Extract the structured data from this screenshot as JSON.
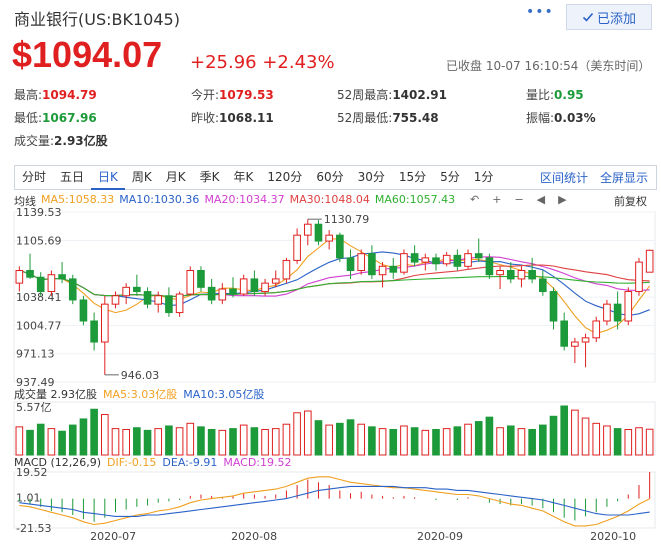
{
  "header": {
    "title": "商业银行(US:BK1045)",
    "dots": "•••",
    "added_label": "已添加",
    "price": "$1094.07",
    "change": "+25.96  +2.43%",
    "status": "已收盘 10-07 16:10:54（美东时间）"
  },
  "stats": [
    {
      "label": "最高:",
      "value": "1094.79",
      "color": "red"
    },
    {
      "label": "今开:",
      "value": "1079.53",
      "color": "red"
    },
    {
      "label": "52周最高:",
      "value": "1402.91",
      "color": "dark"
    },
    {
      "label": "量比:",
      "value": "0.95",
      "color": "green"
    },
    {
      "label": "最低:",
      "value": "1067.96",
      "color": "green"
    },
    {
      "label": "昨收:",
      "value": "1068.11",
      "color": "dark"
    },
    {
      "label": "52周最低:",
      "value": "755.48",
      "color": "dark"
    },
    {
      "label": "振幅:",
      "value": "0.03%",
      "color": "dark"
    },
    {
      "label": "成交量:",
      "value": "2.93亿股",
      "color": "dark"
    }
  ],
  "tabs": [
    "分时",
    "五日",
    "日K",
    "周K",
    "月K",
    "季K",
    "年K",
    "120分",
    "60分",
    "30分",
    "15分",
    "5分",
    "1分"
  ],
  "active_tab": "日K",
  "tab_links": [
    "区间统计",
    "全屏显示"
  ],
  "ma": {
    "label": "均线",
    "ma5": "MA5:1058.33",
    "ma10": "MA10:1030.36",
    "ma20": "MA20:1034.37",
    "ma30": "MA30:1048.04",
    "ma60": "MA60:1057.43"
  },
  "ma_colors": {
    "ma5": "#f0a020",
    "ma10": "#2a62c8",
    "ma20": "#d040d0",
    "ma30": "#e04040",
    "ma60": "#30b030"
  },
  "controls": [
    "↶",
    "+",
    "−",
    "◀",
    "▶"
  ],
  "fuquan": "前复权",
  "price_axis": [
    "1139.53",
    "1105.69",
    "1038.41",
    "1004.77",
    "971.13",
    "937.49"
  ],
  "annotations": {
    "high": "1130.79",
    "low": "946.03"
  },
  "volume": {
    "label": "成交量 2.93亿股",
    "ma5": "MA5:3.03亿股",
    "ma10": "MA10:3.05亿股",
    "axis_max": "5.57亿"
  },
  "macd": {
    "label": "MACD (12,26,9)",
    "dif": "DIF:-0.15",
    "dea": "DEA:-9.91",
    "macd": "MACD:19.52",
    "axis": [
      "19.52",
      "1.01",
      "-21.53"
    ]
  },
  "x_axis": [
    "2020-07",
    "2020-08",
    "2020-09",
    "2020-10"
  ],
  "chart_data": {
    "type": "candlestick",
    "ylim": [
      937.49,
      1139.53
    ],
    "candles": [
      [
        1055,
        1075,
        1045,
        1070
      ],
      [
        1070,
        1090,
        1060,
        1062
      ],
      [
        1062,
        1068,
        1040,
        1045
      ],
      [
        1045,
        1070,
        1040,
        1065
      ],
      [
        1065,
        1080,
        1055,
        1060
      ],
      [
        1060,
        1065,
        1030,
        1035
      ],
      [
        1035,
        1040,
        1005,
        1010
      ],
      [
        1010,
        1020,
        975,
        985
      ],
      [
        985,
        1040,
        946,
        1030
      ],
      [
        1030,
        1045,
        1025,
        1040
      ],
      [
        1040,
        1055,
        1030,
        1050
      ],
      [
        1050,
        1065,
        1040,
        1045
      ],
      [
        1045,
        1050,
        1025,
        1030
      ],
      [
        1030,
        1045,
        1020,
        1040
      ],
      [
        1040,
        1050,
        1015,
        1020
      ],
      [
        1020,
        1045,
        1015,
        1042
      ],
      [
        1042,
        1075,
        1040,
        1070
      ],
      [
        1070,
        1075,
        1045,
        1050
      ],
      [
        1050,
        1060,
        1030,
        1035
      ],
      [
        1035,
        1055,
        1030,
        1048
      ],
      [
        1048,
        1062,
        1038,
        1042
      ],
      [
        1042,
        1065,
        1040,
        1060
      ],
      [
        1060,
        1070,
        1040,
        1045
      ],
      [
        1045,
        1060,
        1040,
        1055
      ],
      [
        1055,
        1070,
        1050,
        1060
      ],
      [
        1060,
        1085,
        1055,
        1082
      ],
      [
        1082,
        1120,
        1078,
        1112
      ],
      [
        1112,
        1131,
        1100,
        1125
      ],
      [
        1125,
        1130,
        1100,
        1105
      ],
      [
        1105,
        1118,
        1095,
        1112
      ],
      [
        1112,
        1115,
        1080,
        1085
      ],
      [
        1085,
        1095,
        1060,
        1070
      ],
      [
        1070,
        1095,
        1065,
        1090
      ],
      [
        1090,
        1100,
        1060,
        1065
      ],
      [
        1065,
        1080,
        1050,
        1075
      ],
      [
        1075,
        1085,
        1060,
        1068
      ],
      [
        1068,
        1095,
        1065,
        1090
      ],
      [
        1090,
        1100,
        1075,
        1080
      ],
      [
        1080,
        1090,
        1070,
        1085
      ],
      [
        1085,
        1090,
        1070,
        1078
      ],
      [
        1078,
        1092,
        1075,
        1088
      ],
      [
        1088,
        1095,
        1070,
        1075
      ],
      [
        1075,
        1095,
        1072,
        1090
      ],
      [
        1090,
        1108,
        1080,
        1085
      ],
      [
        1085,
        1090,
        1060,
        1065
      ],
      [
        1065,
        1075,
        1048,
        1070
      ],
      [
        1070,
        1080,
        1055,
        1060
      ],
      [
        1060,
        1075,
        1050,
        1070
      ],
      [
        1070,
        1085,
        1055,
        1060
      ],
      [
        1060,
        1070,
        1040,
        1045
      ],
      [
        1045,
        1050,
        1000,
        1010
      ],
      [
        1010,
        1020,
        975,
        980
      ],
      [
        980,
        990,
        960,
        985
      ],
      [
        985,
        995,
        955,
        990
      ],
      [
        990,
        1015,
        985,
        1010
      ],
      [
        1010,
        1035,
        1005,
        1030
      ],
      [
        1030,
        1045,
        1000,
        1010
      ],
      [
        1010,
        1050,
        1005,
        1045
      ],
      [
        1045,
        1085,
        1040,
        1080
      ],
      [
        1068,
        1095,
        1068,
        1094
      ]
    ],
    "volumes": [
      3.2,
      2.8,
      3.5,
      3.0,
      2.7,
      3.4,
      4.1,
      5.2,
      4.6,
      3.0,
      2.9,
      3.1,
      2.8,
      3.0,
      3.3,
      3.1,
      3.6,
      3.2,
      2.9,
      2.8,
      3.0,
      3.4,
      3.1,
      2.9,
      3.0,
      3.5,
      4.8,
      5.0,
      3.9,
      3.4,
      3.6,
      4.0,
      3.5,
      3.2,
      3.0,
      2.9,
      3.3,
      3.1,
      2.8,
      2.9,
      3.0,
      3.2,
      3.5,
      3.8,
      4.3,
      3.1,
      3.3,
      3.0,
      2.9,
      3.4,
      4.4,
      5.57,
      5.1,
      4.2,
      3.6,
      3.3,
      3.0,
      2.9,
      3.1,
      2.93
    ],
    "macd_hist": [
      -2,
      -4,
      -6,
      -9,
      -10,
      -12,
      -15,
      -17,
      -14,
      -10,
      -8,
      -6,
      -5,
      -3,
      -2,
      -1,
      2,
      3,
      2,
      1,
      2,
      4,
      3,
      2,
      3,
      6,
      10,
      14,
      12,
      10,
      6,
      4,
      5,
      3,
      2,
      1,
      2,
      1,
      0,
      -1,
      0,
      -1,
      1,
      0,
      -3,
      -4,
      -5,
      -4,
      -5,
      -7,
      -10,
      -14,
      -16,
      -13,
      -10,
      -6,
      -2,
      3,
      10,
      19.52
    ],
    "dif": [
      -5,
      -6,
      -8,
      -10,
      -12,
      -14,
      -17,
      -19,
      -18,
      -16,
      -14,
      -12,
      -11,
      -9,
      -8,
      -6,
      -3,
      -1,
      0,
      1,
      2,
      4,
      5,
      6,
      7,
      9,
      12,
      15,
      16,
      16,
      14,
      12,
      11,
      10,
      9,
      8,
      8,
      7,
      6,
      5,
      4,
      3,
      3,
      2,
      0,
      -2,
      -4,
      -5,
      -7,
      -9,
      -13,
      -17,
      -20,
      -20,
      -19,
      -16,
      -13,
      -9,
      -4,
      -0.15
    ],
    "dea": [
      -3,
      -4,
      -5,
      -6,
      -7,
      -8,
      -10,
      -11,
      -12,
      -13,
      -13,
      -13,
      -12,
      -12,
      -11,
      -10,
      -9,
      -8,
      -7,
      -6,
      -5,
      -4,
      -3,
      -2,
      -1,
      0,
      2,
      4,
      6,
      7,
      8,
      9,
      9,
      9,
      9,
      9,
      8,
      8,
      8,
      7,
      7,
      6,
      6,
      5,
      4,
      3,
      2,
      1,
      0,
      -1,
      -3,
      -5,
      -7,
      -9,
      -11,
      -12,
      -12,
      -12,
      -11,
      -9.91
    ]
  }
}
